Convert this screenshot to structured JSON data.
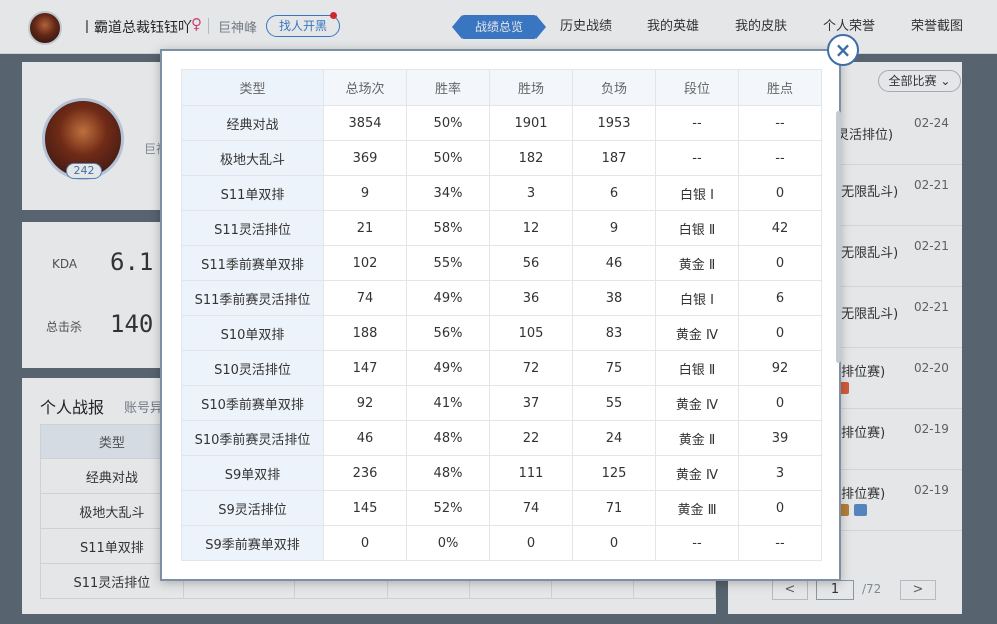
{
  "header": {
    "player_name": "丨霸道总裁钰钰吖",
    "gender_symbol": "♀",
    "server": "巨神峰",
    "find_button": "找人开黑",
    "nav": [
      "战绩总览",
      "历史战绩",
      "我的英雄",
      "我的皮肤",
      "个人荣誉",
      "荣誉截图"
    ],
    "active_nav": "战绩总览"
  },
  "profile": {
    "name_stub": "丨",
    "sub_stub": "巨神",
    "level": "242"
  },
  "stats": {
    "kda_label": "KDA",
    "kda_value": "6.1",
    "kills_label": "总击杀",
    "kills_value": "140"
  },
  "report": {
    "title": "个人战报",
    "subtitle": "账号异",
    "header": "类型",
    "rows": [
      "经典对战",
      "极地大乱斗",
      "S11单双排",
      "S11灵活排位"
    ]
  },
  "right_panel": {
    "filter": "全部比赛",
    "matches": [
      {
        "mode": "灵活排位)",
        "date": "02-24"
      },
      {
        "mode": "(无限乱斗)",
        "date": "02-21"
      },
      {
        "mode": "(无限乱斗)",
        "date": "02-21"
      },
      {
        "mode": "(无限乱斗)",
        "date": "02-21"
      },
      {
        "mode": "(排位赛)",
        "date": "02-20"
      },
      {
        "mode": "(排位赛)",
        "date": "02-19"
      },
      {
        "mode": "(排位赛)",
        "date": "02-19"
      }
    ],
    "pager": {
      "prev": "<",
      "current": "1",
      "total": "/72",
      "next": ">"
    }
  },
  "modal": {
    "close": "×",
    "columns": [
      "类型",
      "总场次",
      "胜率",
      "胜场",
      "负场",
      "段位",
      "胜点"
    ],
    "rows": [
      [
        "经典对战",
        "3854",
        "50%",
        "1901",
        "1953",
        "--",
        "--"
      ],
      [
        "极地大乱斗",
        "369",
        "50%",
        "182",
        "187",
        "--",
        "--"
      ],
      [
        "S11单双排",
        "9",
        "34%",
        "3",
        "6",
        "白银 Ⅰ",
        "0"
      ],
      [
        "S11灵活排位",
        "21",
        "58%",
        "12",
        "9",
        "白银 Ⅱ",
        "42"
      ],
      [
        "S11季前赛单双排",
        "102",
        "55%",
        "56",
        "46",
        "黄金 Ⅱ",
        "0"
      ],
      [
        "S11季前赛灵活排位",
        "74",
        "49%",
        "36",
        "38",
        "白银 Ⅰ",
        "6"
      ],
      [
        "S10单双排",
        "188",
        "56%",
        "105",
        "83",
        "黄金 Ⅳ",
        "0"
      ],
      [
        "S10灵活排位",
        "147",
        "49%",
        "72",
        "75",
        "白银 Ⅱ",
        "92"
      ],
      [
        "S10季前赛单双排",
        "92",
        "41%",
        "37",
        "55",
        "黄金 Ⅳ",
        "0"
      ],
      [
        "S10季前赛灵活排位",
        "46",
        "48%",
        "22",
        "24",
        "黄金 Ⅱ",
        "39"
      ],
      [
        "S9单双排",
        "236",
        "48%",
        "111",
        "125",
        "黄金 Ⅳ",
        "3"
      ],
      [
        "S9灵活排位",
        "145",
        "52%",
        "74",
        "71",
        "黄金 Ⅲ",
        "0"
      ],
      [
        "S9季前赛单双排",
        "0",
        "0%",
        "0",
        "0",
        "--",
        "--"
      ]
    ]
  },
  "colors": {
    "accent": "#3c7fd3",
    "win": "#239b46",
    "lose": "#d9363e",
    "female": "#e2477e"
  }
}
